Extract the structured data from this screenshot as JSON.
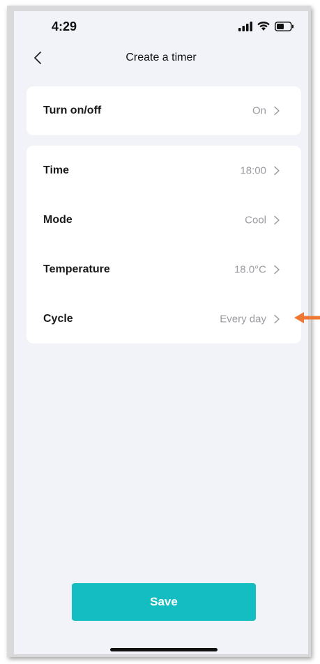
{
  "status_bar": {
    "time": "4:29",
    "icons": [
      "signal-icon",
      "wifi-icon",
      "battery-icon"
    ]
  },
  "nav": {
    "back_icon": "chevron-left-icon",
    "title": "Create a timer"
  },
  "power_card": {
    "rows": [
      {
        "label": "Turn on/off",
        "value": "On"
      }
    ]
  },
  "settings_card": {
    "rows": [
      {
        "label": "Time",
        "value": "18:00"
      },
      {
        "label": "Mode",
        "value": "Cool"
      },
      {
        "label": "Temperature",
        "value": "18.0°C"
      },
      {
        "label": "Cycle",
        "value": "Every day"
      }
    ]
  },
  "save_button": {
    "label": "Save"
  },
  "colors": {
    "accent": "#13bdc1",
    "background": "#f2f3f8",
    "card": "#ffffff",
    "value_text": "#9a9ba1",
    "annotation_arrow": "#ee7733"
  }
}
